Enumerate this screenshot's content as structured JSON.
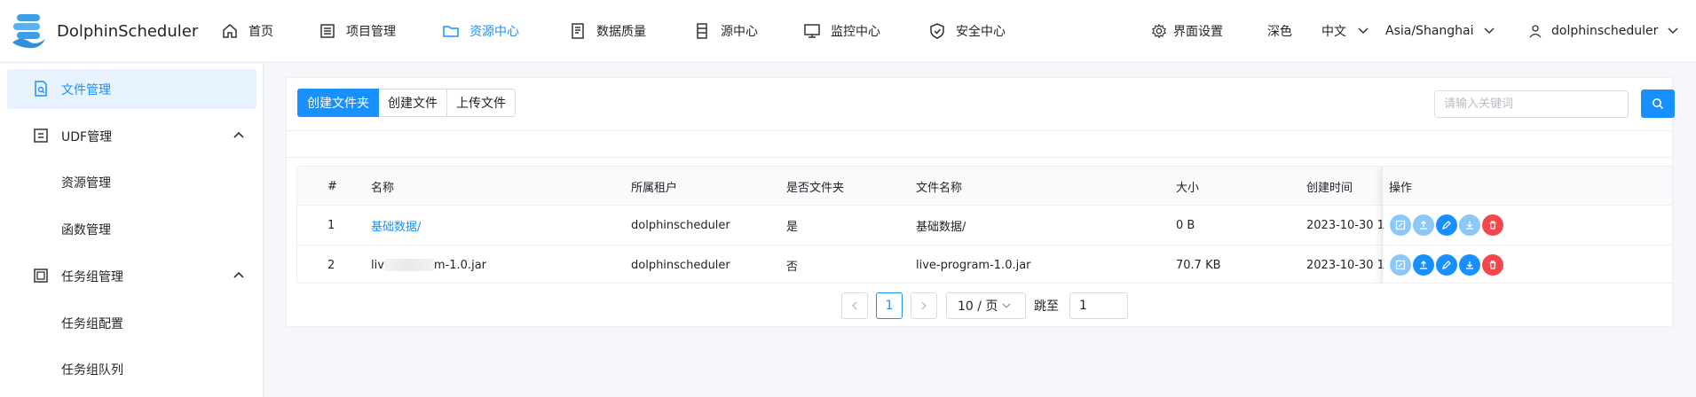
{
  "app": {
    "name": "DolphinScheduler",
    "accent": "#1890ff"
  },
  "nav": [
    {
      "label": "首页",
      "icon": "home-icon"
    },
    {
      "label": "项目管理",
      "icon": "project-list-icon"
    },
    {
      "label": "资源中心",
      "icon": "folder-icon",
      "active": true
    },
    {
      "label": "数据质量",
      "icon": "data-quality-icon"
    },
    {
      "label": "源中心",
      "icon": "datasource-icon"
    },
    {
      "label": "监控中心",
      "icon": "monitor-icon"
    },
    {
      "label": "安全中心",
      "icon": "shield-icon"
    }
  ],
  "header_right": {
    "settings_label": "界面设置",
    "theme_label": "深色",
    "language": "中文",
    "timezone": "Asia/Shanghai",
    "user": "dolphinscheduler"
  },
  "sidebar": {
    "items": [
      {
        "label": "文件管理",
        "icon": "file-search-icon",
        "active": true
      },
      {
        "label": "UDF管理",
        "icon": "udf-icon",
        "expanded": true
      },
      {
        "label": "资源管理"
      },
      {
        "label": "函数管理"
      },
      {
        "label": "任务组管理",
        "icon": "task-group-icon",
        "expanded": true
      },
      {
        "label": "任务组配置"
      },
      {
        "label": "任务组队列"
      }
    ]
  },
  "toolbar": {
    "create_folder": "创建文件夹",
    "create_file": "创建文件",
    "upload_file": "上传文件",
    "search_placeholder": "请输入关键词"
  },
  "table": {
    "headers": [
      "#",
      "名称",
      "所属租户",
      "是否文件夹",
      "文件名称",
      "大小",
      "创建时间",
      "操作"
    ],
    "rows": [
      {
        "index": "1",
        "name": "基础数据/",
        "tenant": "dolphinscheduler",
        "is_folder": "是",
        "file_name": "基础数据/",
        "size": "0 B",
        "created": "2023-10-30 1"
      },
      {
        "index": "2",
        "name_prefix": "liv",
        "name_suffix": "m-1.0.jar",
        "tenant": "dolphinscheduler",
        "is_folder": "否",
        "file_name": "live-program-1.0.jar",
        "size": "70.7 KB",
        "created": "2023-10-30 1"
      }
    ]
  },
  "pagination": {
    "prev": "<",
    "current": "1",
    "next": ">",
    "page_size": "10 / 页",
    "jump_label": "跳至",
    "jump_value": "1"
  }
}
